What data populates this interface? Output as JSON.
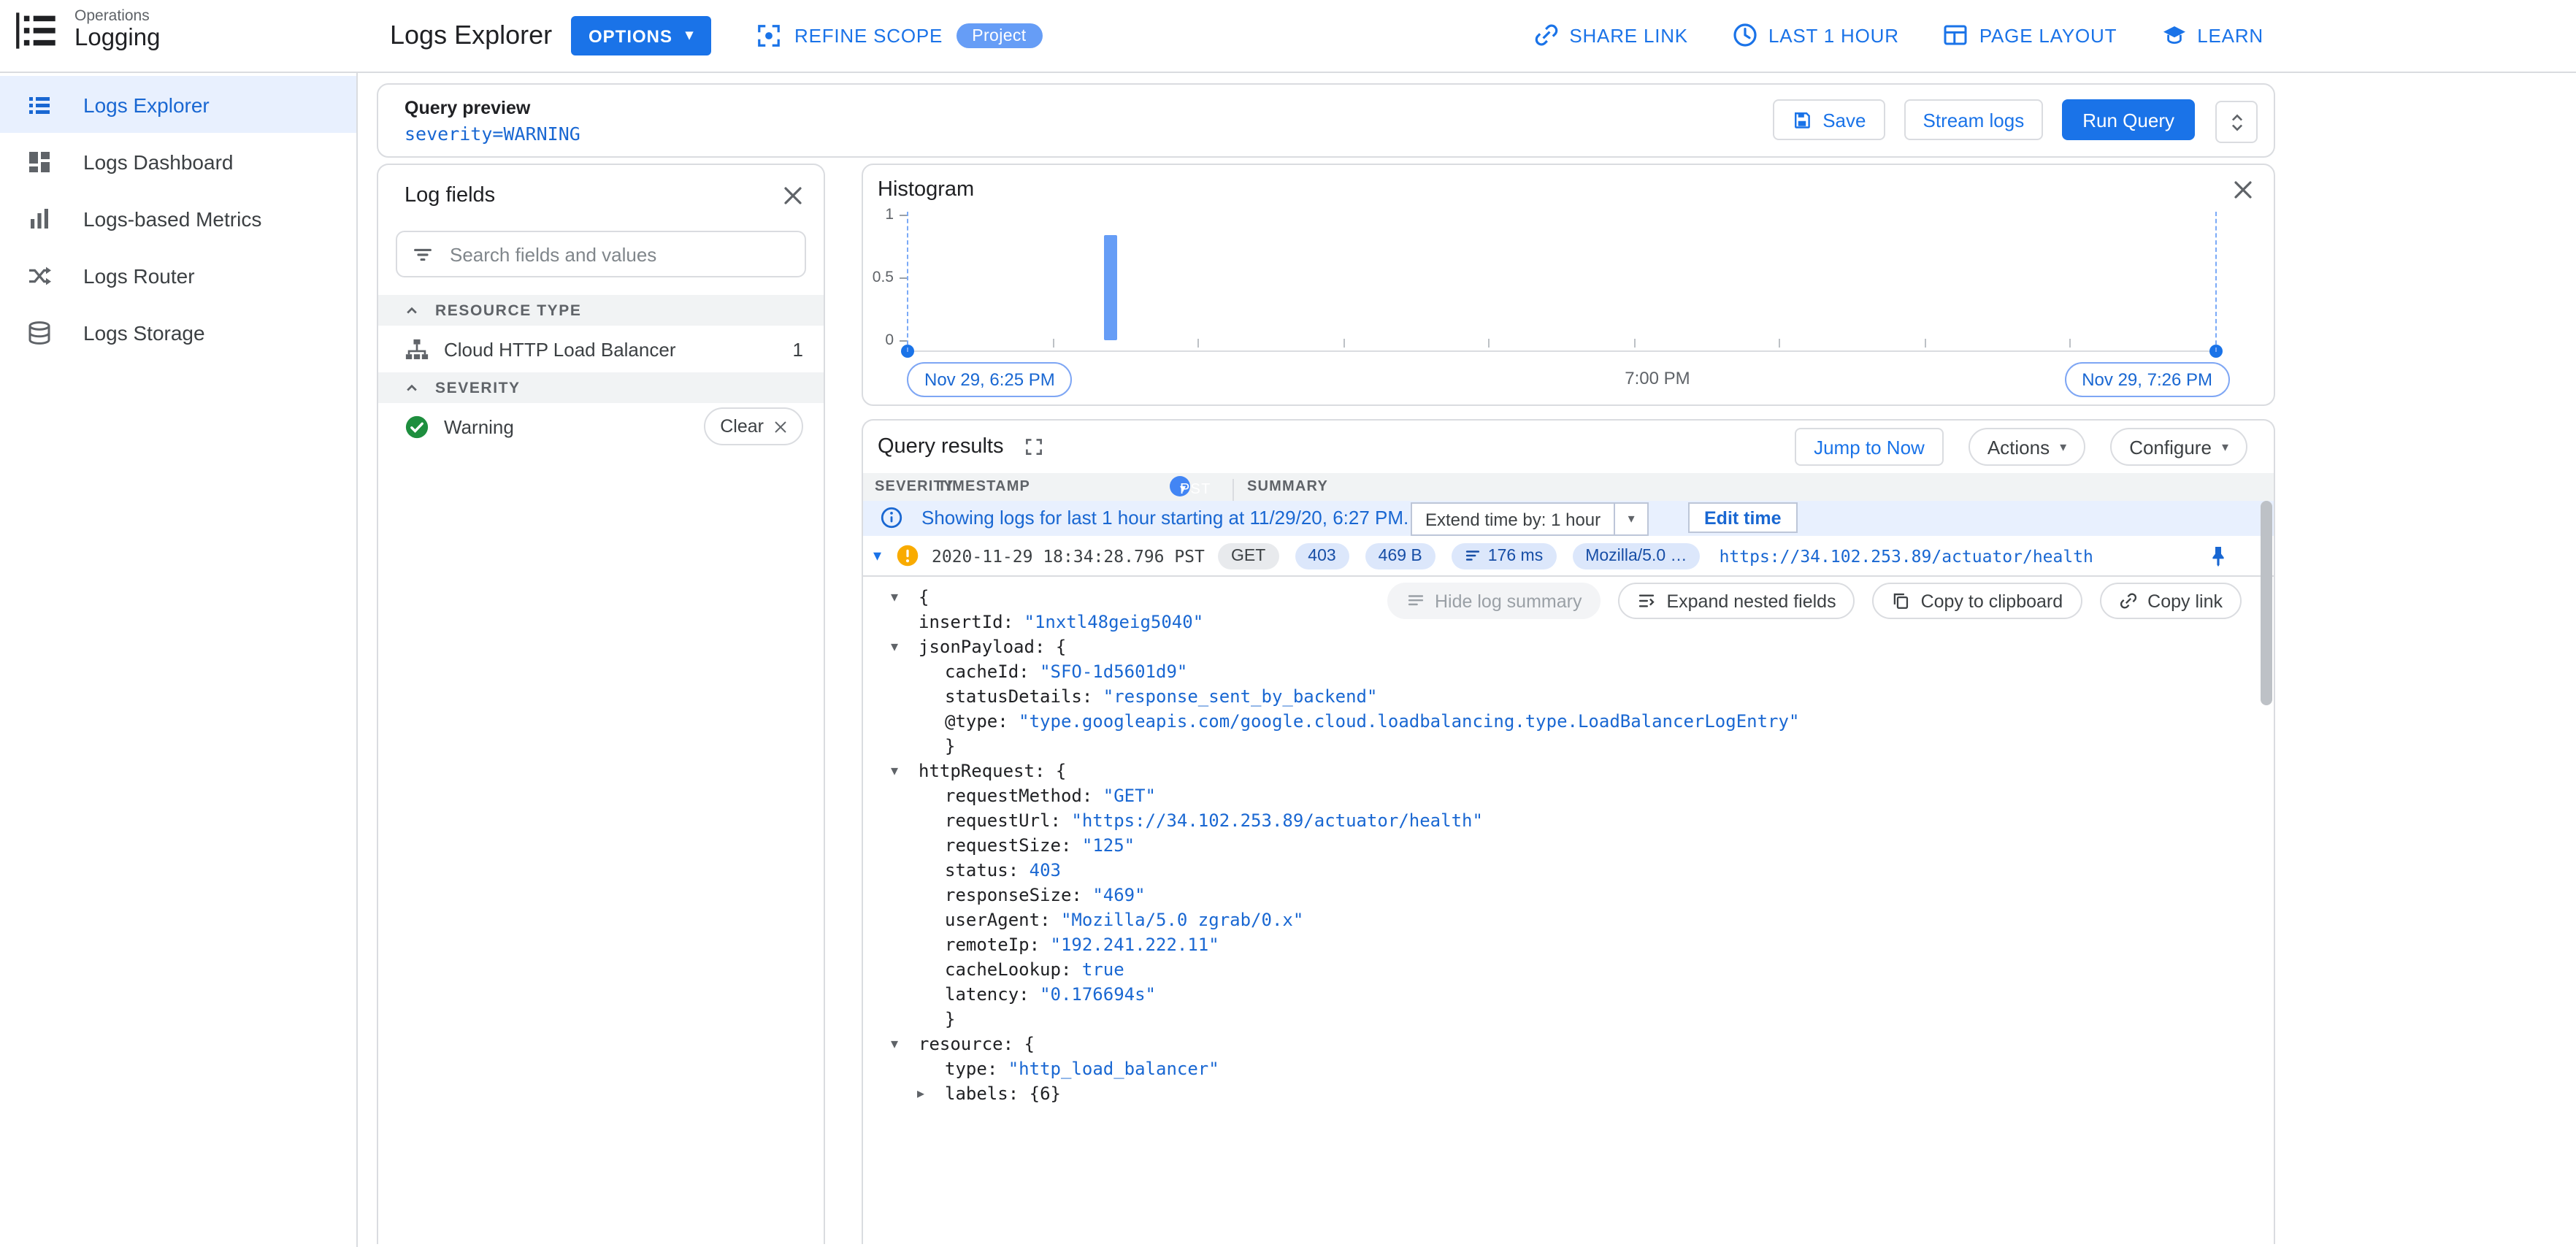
{
  "colors": {
    "accent_blue": "#1a73e8",
    "link_blue": "#1967d2",
    "selected_bg": "#e8f0fe",
    "border": "#dadce0",
    "text": "#202124",
    "text_secondary": "#5f6368",
    "warning_orange": "#f9ab00",
    "success_green": "#1e8e3e",
    "histogram_bar": "#669df6"
  },
  "topbar": {
    "brand_top": "Operations",
    "brand_bottom": "Logging",
    "page_title": "Logs Explorer",
    "options_button": "OPTIONS",
    "refine_scope_label": "REFINE SCOPE",
    "refine_scope_badge": "Project",
    "actions": [
      {
        "label": "SHARE LINK",
        "icon": "share-link-icon"
      },
      {
        "label": "LAST 1 HOUR",
        "icon": "clock-icon"
      },
      {
        "label": "PAGE LAYOUT",
        "icon": "page-layout-icon"
      },
      {
        "label": "LEARN",
        "icon": "learn-icon"
      }
    ]
  },
  "sidebar": {
    "items": [
      {
        "label": "Logs Explorer",
        "icon": "logs-explorer-icon",
        "active": true
      },
      {
        "label": "Logs Dashboard",
        "icon": "logs-dashboard-icon",
        "active": false
      },
      {
        "label": "Logs-based Metrics",
        "icon": "logs-metrics-icon",
        "active": false
      },
      {
        "label": "Logs Router",
        "icon": "logs-router-icon",
        "active": false
      },
      {
        "label": "Logs Storage",
        "icon": "logs-storage-icon",
        "active": false
      }
    ]
  },
  "query_preview": {
    "label": "Query preview",
    "query": "severity=WARNING",
    "save_button": "Save",
    "stream_logs_button": "Stream logs",
    "run_query_button": "Run Query"
  },
  "log_fields": {
    "title": "Log fields",
    "search_placeholder": "Search fields and values",
    "sections": [
      {
        "header": "RESOURCE TYPE",
        "items": [
          {
            "icon": "load-balancer-icon",
            "label": "Cloud HTTP Load Balancer",
            "count": "1"
          }
        ]
      },
      {
        "header": "SEVERITY",
        "items": [
          {
            "icon": "check-circle-icon",
            "label": "Warning",
            "clear_label": "Clear"
          }
        ]
      }
    ]
  },
  "histogram": {
    "title": "Histogram",
    "start_time_label": "Nov 29, 6:25 PM",
    "mid_time_label": "7:00 PM",
    "end_time_label": "Nov 29, 7:26 PM",
    "chart_data": {
      "type": "bar",
      "title": "Histogram",
      "x_range": [
        "Nov 29, 6:25 PM",
        "Nov 29, 7:26 PM"
      ],
      "y_ticks": [
        0,
        0.5,
        1
      ],
      "ylim": [
        0,
        1
      ],
      "bars": [
        {
          "x_fraction": 0.155,
          "approx_time": "Nov 29, 6:34 PM",
          "value": 1
        }
      ]
    }
  },
  "query_results": {
    "title": "Query results",
    "jump_to_now_button": "Jump to Now",
    "actions_button": "Actions",
    "configure_button": "Configure",
    "columns": {
      "severity": "SEVERITY",
      "timestamp": "TIMESTAMP",
      "timezone": "PST",
      "summary": "SUMMARY"
    },
    "info_banner": {
      "text": "Showing logs for last 1 hour starting at 11/29/20, 6:27 PM.",
      "extend_label": "Extend time by: 1 hour",
      "edit_time_button": "Edit time"
    },
    "entry": {
      "severity": "WARNING",
      "timestamp": "2020-11-29 18:34:28.796 PST",
      "chips": [
        {
          "label": "GET",
          "variant": "gray"
        },
        {
          "label": "403",
          "variant": "blue"
        },
        {
          "label": "469 B",
          "variant": "blue"
        },
        {
          "label": "176 ms",
          "variant": "blue",
          "icon": "latency-sort-icon"
        },
        {
          "label": "Mozilla/5.0 …",
          "variant": "blue"
        }
      ],
      "url": "https://34.102.253.89/actuator/health"
    },
    "toolbar_buttons": [
      {
        "label": "Hide log summary",
        "icon": "summary-icon",
        "disabled": true
      },
      {
        "label": "Expand nested fields",
        "icon": "expand-nested-icon",
        "disabled": false
      },
      {
        "label": "Copy to clipboard",
        "icon": "copy-icon",
        "disabled": false
      },
      {
        "label": "Copy link",
        "icon": "copy-link-icon",
        "disabled": false
      }
    ],
    "json_lines": [
      {
        "indent": 0,
        "arrow": "down",
        "plain": "{"
      },
      {
        "indent": 1,
        "key": "insertId",
        "value": "\"1nxtl48geig5040\""
      },
      {
        "indent": 1,
        "arrow": "down",
        "key": "jsonPayload",
        "plain": "{"
      },
      {
        "indent": 2,
        "key": "cacheId",
        "value": "\"SFO-1d5601d9\""
      },
      {
        "indent": 2,
        "key": "statusDetails",
        "value": "\"response_sent_by_backend\""
      },
      {
        "indent": 2,
        "key": "@type",
        "value": "\"type.googleapis.com/google.cloud.loadbalancing.type.LoadBalancerLogEntry\""
      },
      {
        "indent": 2,
        "plain": "}"
      },
      {
        "indent": 1,
        "arrow": "down",
        "key": "httpRequest",
        "plain": "{"
      },
      {
        "indent": 2,
        "key": "requestMethod",
        "value": "\"GET\""
      },
      {
        "indent": 2,
        "key": "requestUrl",
        "value": "\"https://34.102.253.89/actuator/health\""
      },
      {
        "indent": 2,
        "key": "requestSize",
        "value": "\"125\""
      },
      {
        "indent": 2,
        "key": "status",
        "value": "403"
      },
      {
        "indent": 2,
        "key": "responseSize",
        "value": "\"469\""
      },
      {
        "indent": 2,
        "key": "userAgent",
        "value": "\"Mozilla/5.0 zgrab/0.x\""
      },
      {
        "indent": 2,
        "key": "remoteIp",
        "value": "\"192.241.222.11\""
      },
      {
        "indent": 2,
        "key": "cacheLookup",
        "value": "true"
      },
      {
        "indent": 2,
        "key": "latency",
        "value": "\"0.176694s\""
      },
      {
        "indent": 2,
        "plain": "}"
      },
      {
        "indent": 1,
        "arrow": "down",
        "key": "resource",
        "plain": "{"
      },
      {
        "indent": 2,
        "key": "type",
        "value": "\"http_load_balancer\""
      },
      {
        "indent": 2,
        "arrow": "right",
        "key": "labels",
        "plain": "{6}"
      }
    ]
  }
}
